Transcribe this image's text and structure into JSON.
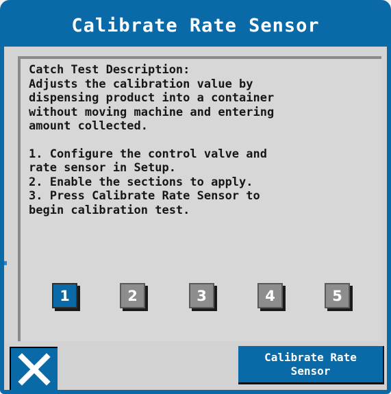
{
  "dialog": {
    "title": "Calibrate Rate Sensor"
  },
  "description": {
    "heading": "Catch Test Description:",
    "body": "Adjusts the calibration value by\ndispensing product into a container\nwithout moving machine and entering\namount collected.",
    "steps": [
      "1. Configure the control valve and\nrate sensor in Setup.",
      "2. Enable the sections to apply.",
      "3. Press Calibrate Rate Sensor to\nbegin calibration test."
    ]
  },
  "sections": [
    {
      "label": "1",
      "active": true
    },
    {
      "label": "2",
      "active": false
    },
    {
      "label": "3",
      "active": false
    },
    {
      "label": "4",
      "active": false
    },
    {
      "label": "5",
      "active": false
    }
  ],
  "actions": {
    "close_icon": "close-x-icon",
    "calibrate_label": "Calibrate Rate\nSensor"
  },
  "colors": {
    "accent": "#0a6aa8",
    "panel": "#d4d4d4",
    "inactive_section": "#8d8d8d"
  }
}
